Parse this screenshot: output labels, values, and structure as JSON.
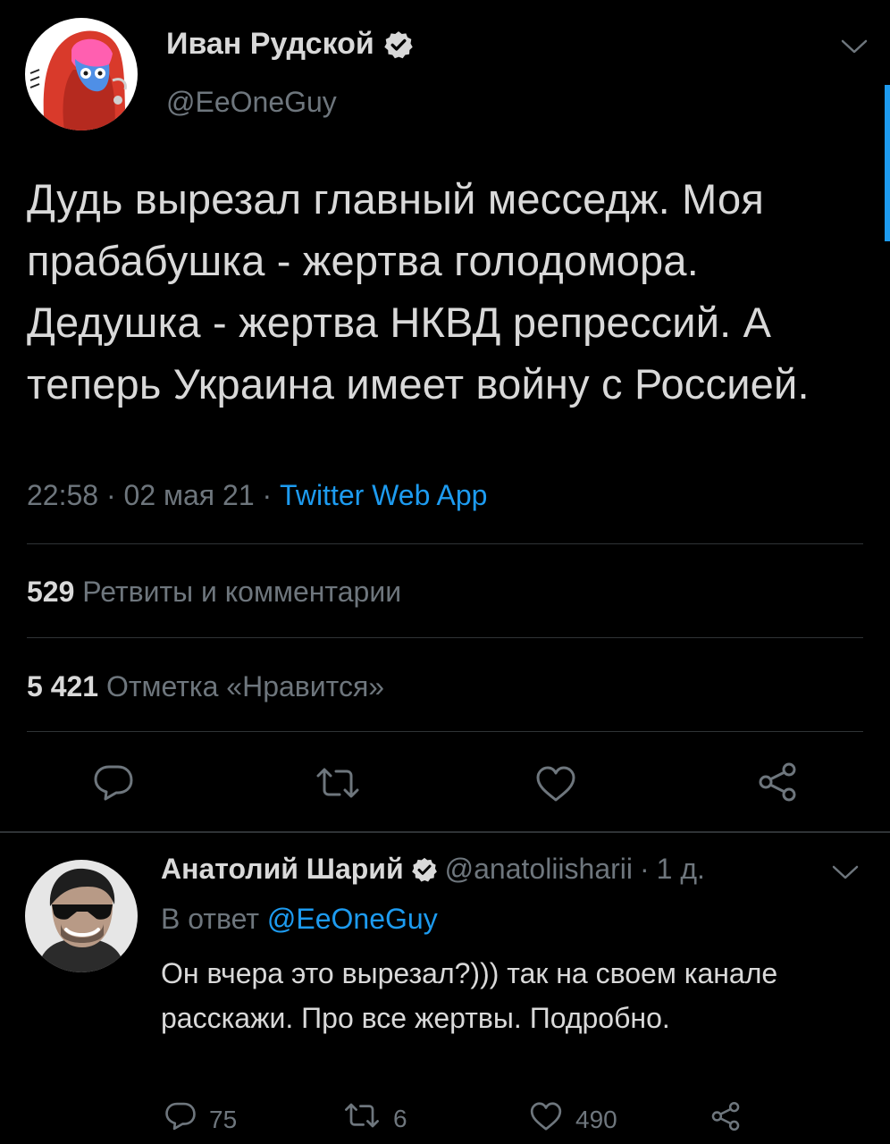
{
  "main_tweet": {
    "author_name": "Иван Рудской",
    "author_handle": "@EeOneGuy",
    "text": "Дудь вырезал главный месседж. Моя прабабушка - жертва голодомора. Дедушка - жертва НКВД репрессий. А теперь Украина имеет войну с Россией.",
    "time": "22:58",
    "date": "02 мая 21",
    "source": "Twitter Web App",
    "retweets_count": "529",
    "retweets_label": "Ретвиты и комментарии",
    "likes_count": "5 421",
    "likes_label": "Отметка «Нравится»",
    "icons": {
      "reply": "reply-icon",
      "retweet": "retweet-icon",
      "like": "heart-icon",
      "share": "share-icon",
      "more": "chevron-down-icon"
    }
  },
  "reply": {
    "author_name": "Анатолий Шарий",
    "author_handle": "@anatoliisharii",
    "time_ago": "1 д.",
    "separator": "·",
    "reply_to_label": "В ответ",
    "reply_to_handle": "@EeOneGuy",
    "text": "Он вчера это вырезал?))) так на своем канале расскажи. Про все жертвы. Подробно.",
    "reply_count": "75",
    "retweet_count": "6",
    "like_count": "490"
  },
  "colors": {
    "background": "#000000",
    "text": "#d9d9d9",
    "secondary": "#6e767d",
    "accent": "#1d9bf0",
    "divider": "#2f3336"
  }
}
